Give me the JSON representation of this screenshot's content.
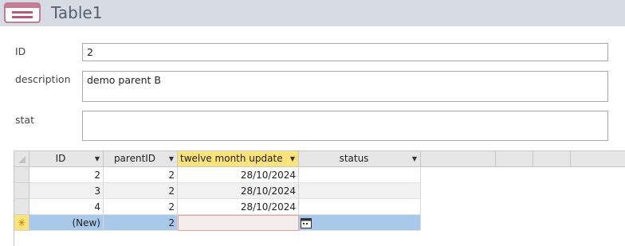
{
  "window": {
    "title": "Table1",
    "icon": "form-icon"
  },
  "form": {
    "fields": [
      {
        "label": "ID",
        "value": "2"
      },
      {
        "label": "description",
        "value": "demo parent B"
      },
      {
        "label": "stat",
        "value": ""
      }
    ]
  },
  "datasheet": {
    "columns": [
      "ID",
      "parentID",
      "twelve month update",
      "status"
    ],
    "rows": [
      {
        "id": "2",
        "parentID": "2",
        "date": "28/10/2024",
        "status": ""
      },
      {
        "id": "3",
        "parentID": "2",
        "date": "28/10/2024",
        "status": ""
      },
      {
        "id": "4",
        "parentID": "2",
        "date": "28/10/2024",
        "status": ""
      }
    ],
    "new_row": {
      "id": "(New)",
      "parentID": "2",
      "date": "",
      "status": "",
      "marker": "✳"
    },
    "colors": {
      "active_header": "#fbe27a",
      "new_row": "#a9c9ea",
      "editing_cell_border": "#e8a0a0"
    }
  }
}
